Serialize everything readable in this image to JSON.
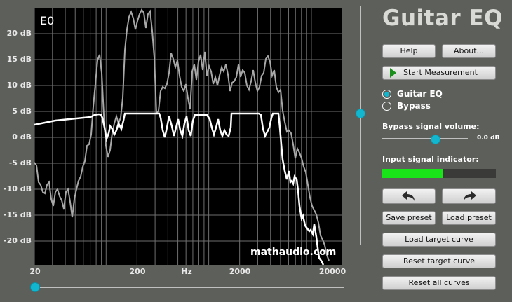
{
  "app": {
    "title": "Guitar EQ"
  },
  "plot": {
    "preset_label": "E0",
    "watermark": "mathaudio.com",
    "y_ticks": [
      "20 dB",
      "15 dB",
      "10 dB",
      "5 dB",
      "0 dB",
      "-5 dB",
      "-10 dB",
      "-15 dB",
      "-20 dB"
    ],
    "x_ticks": [
      "20",
      "200",
      "Hz",
      "2000",
      "20000"
    ]
  },
  "buttons": {
    "help": "Help",
    "about": "About...",
    "start_measurement": "Start Measurement",
    "save_preset": "Save preset",
    "load_preset": "Load preset",
    "load_target_curve": "Load target curve",
    "reset_target_curve": "Reset target curve",
    "reset_all_curves": "Reset all curves"
  },
  "mode": {
    "options": [
      {
        "label": "Guitar EQ",
        "selected": true
      },
      {
        "label": "Bypass",
        "selected": false
      }
    ]
  },
  "bypass_volume": {
    "label": "Bypass signal volume:",
    "value": "0.0 dB",
    "level": 0.62
  },
  "input_indicator": {
    "label": "Input signal indicator:",
    "level": 0.53
  },
  "vertical_slider_level": 0.55,
  "horizontal_slider_level": 0.0,
  "colors": {
    "accent": "#12b7cf",
    "meter": "#19e319",
    "curve_response": "#a8a8a8",
    "curve_target": "#ffffff",
    "background": "#5d5f5b"
  },
  "icons": {
    "undo": "undo-arrow-icon",
    "redo": "redo-arrow-icon",
    "play": "play-icon"
  }
}
